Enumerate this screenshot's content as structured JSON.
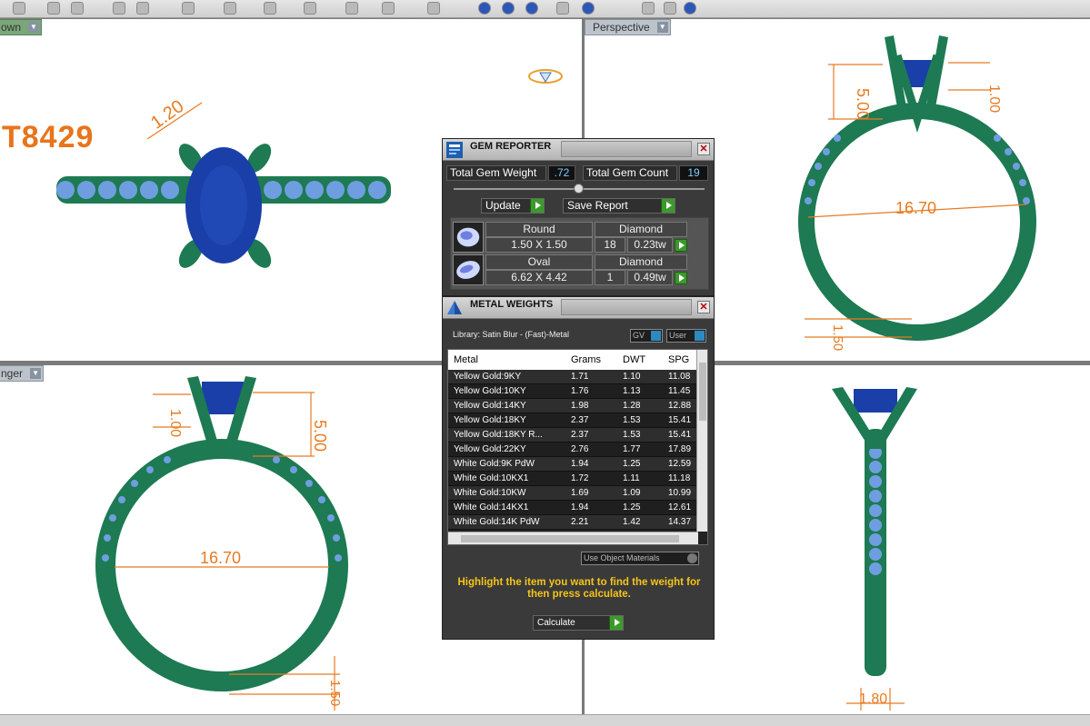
{
  "viewports": {
    "top_left": {
      "label": "own"
    },
    "top_right": {
      "label": "Perspective"
    },
    "bottom_left": {
      "label": "nger"
    }
  },
  "product_code": "T8429",
  "dimensions": {
    "tl_prong": "1.20",
    "tr_height": "5.00",
    "tr_prong": "1.00",
    "tr_width": "16.70",
    "tr_band": "1.50",
    "bl_prong": "1.00",
    "bl_height": "5.00",
    "bl_width": "16.70",
    "bl_band": "1.50",
    "br_band": "1.80"
  },
  "gem_reporter": {
    "title": "GEM REPORTER",
    "total_weight_label": "Total Gem Weight",
    "total_weight_value": ".72",
    "total_count_label": "Total Gem Count",
    "total_count_value": "19",
    "update_label": "Update",
    "save_report_label": "Save Report",
    "gems": [
      {
        "shape": "Round",
        "material": "Diamond",
        "size": "1.50 X 1.50",
        "count": "18",
        "weight": "0.23tw"
      },
      {
        "shape": "Oval",
        "material": "Diamond",
        "size": "6.62 X 4.42",
        "count": "1",
        "weight": "0.49tw"
      }
    ]
  },
  "metal_weights": {
    "title": "METAL WEIGHTS",
    "library": "Library: Satin Blur - (Fast)-Metal",
    "toggle_gv": "GV",
    "toggle_user": "User",
    "columns": [
      "Metal",
      "Grams",
      "DWT",
      "SPG"
    ],
    "rows": [
      {
        "metal": "Yellow Gold:9KY",
        "grams": "1.71",
        "dwt": "1.10",
        "spg": "11.08"
      },
      {
        "metal": "Yellow Gold:10KY",
        "grams": "1.76",
        "dwt": "1.13",
        "spg": "11.45"
      },
      {
        "metal": "Yellow Gold:14KY",
        "grams": "1.98",
        "dwt": "1.28",
        "spg": "12.88"
      },
      {
        "metal": "Yellow Gold:18KY",
        "grams": "2.37",
        "dwt": "1.53",
        "spg": "15.41"
      },
      {
        "metal": "Yellow Gold:18KY R...",
        "grams": "2.37",
        "dwt": "1.53",
        "spg": "15.41"
      },
      {
        "metal": "Yellow Gold:22KY",
        "grams": "2.76",
        "dwt": "1.77",
        "spg": "17.89"
      },
      {
        "metal": "White Gold:9K PdW",
        "grams": "1.94",
        "dwt": "1.25",
        "spg": "12.59"
      },
      {
        "metal": "White Gold:10KX1",
        "grams": "1.72",
        "dwt": "1.11",
        "spg": "11.18"
      },
      {
        "metal": "White Gold:10KW",
        "grams": "1.69",
        "dwt": "1.09",
        "spg": "10.99"
      },
      {
        "metal": "White Gold:14KX1",
        "grams": "1.94",
        "dwt": "1.25",
        "spg": "12.61"
      },
      {
        "metal": "White Gold:14K PdW",
        "grams": "2.21",
        "dwt": "1.42",
        "spg": "14.37"
      }
    ],
    "use_object_materials": "Use Object Materials",
    "instruction": "Highlight the item you want to find the weight for then press calculate.",
    "calculate_label": "Calculate"
  },
  "colors": {
    "metal_green": "#1d7a52",
    "gem_blue": "#1a3fa8",
    "side_stone": "#6f9ee0",
    "dimension_orange": "#e87a22",
    "accent_yellow": "#f5c518"
  }
}
